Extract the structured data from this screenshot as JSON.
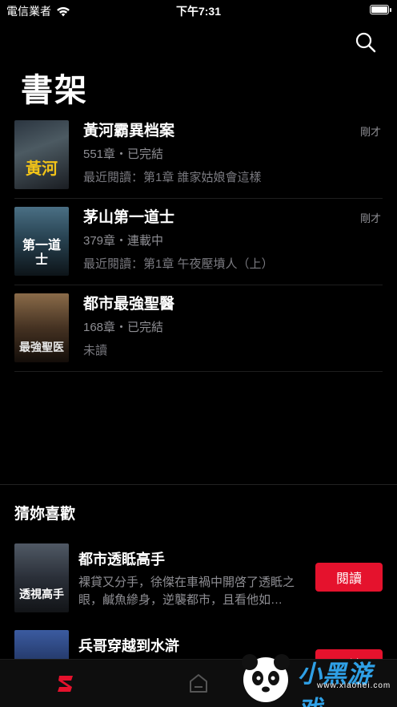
{
  "status_bar": {
    "carrier": "電信業者",
    "time": "下午7:31",
    "battery_level": 1.0
  },
  "header": {
    "title": "書架",
    "search_icon": "search-icon"
  },
  "shelf": {
    "books": [
      {
        "title": "黃河霸異档案",
        "meta": "551章・已完結",
        "last_read": "最近閱讀：第1章 誰家姑娘會這樣",
        "updated": "剛才",
        "cover_text": "黃河"
      },
      {
        "title": "茅山第一道士",
        "meta": "379章・連載中",
        "last_read": "最近閱讀：第1章 午夜壓墳人（上）",
        "updated": "剛才",
        "cover_text": "第一道士"
      },
      {
        "title": "都市最強聖醫",
        "meta": "168章・已完結",
        "last_read": "未讀",
        "updated": "",
        "cover_text": "最強聖医"
      }
    ]
  },
  "recommend": {
    "title": "猜妳喜歡",
    "items": [
      {
        "title": "都市透眡高手",
        "description": "裸貸又分手，徐傑在車禍中開啓了透眡之眼，鹹魚縿身，逆襲都市，且看他如…",
        "button_label": "閱讀",
        "cover_text": "透視高手"
      },
      {
        "title": "兵哥穿越到水滸",
        "description": "",
        "button_label": "閱讀",
        "cover_text": ""
      }
    ]
  },
  "tab_bar": {
    "items": [
      {
        "icon": "shelf-logo-icon",
        "active": true
      },
      {
        "icon": "home-icon",
        "active": false
      }
    ]
  },
  "watermark": {
    "text": "小黑游戏",
    "sub": "www.xiaohei.com"
  },
  "colors": {
    "accent": "#e5122d",
    "background": "#000000",
    "secondary_text": "#8e8e93"
  }
}
